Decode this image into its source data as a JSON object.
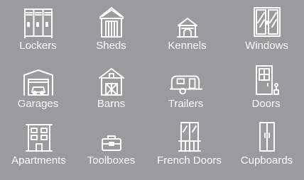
{
  "categories": [
    {
      "label": "Lockers",
      "icon": "lockers-icon"
    },
    {
      "label": "Sheds",
      "icon": "shed-icon"
    },
    {
      "label": "Kennels",
      "icon": "kennel-icon"
    },
    {
      "label": "Windows",
      "icon": "window-icon"
    },
    {
      "label": "Garages",
      "icon": "garage-icon"
    },
    {
      "label": "Barns",
      "icon": "barn-icon"
    },
    {
      "label": "Trailers",
      "icon": "trailer-icon"
    },
    {
      "label": "Doors",
      "icon": "door-icon"
    },
    {
      "label": "Apartments",
      "icon": "apartment-icon"
    },
    {
      "label": "Toolboxes",
      "icon": "toolbox-icon"
    },
    {
      "label": "French Doors",
      "icon": "french-doors-icon"
    },
    {
      "label": "Cupboards",
      "icon": "cupboard-icon"
    }
  ],
  "colors": {
    "background": "#9a9b9d",
    "foreground": "#ffffff"
  }
}
